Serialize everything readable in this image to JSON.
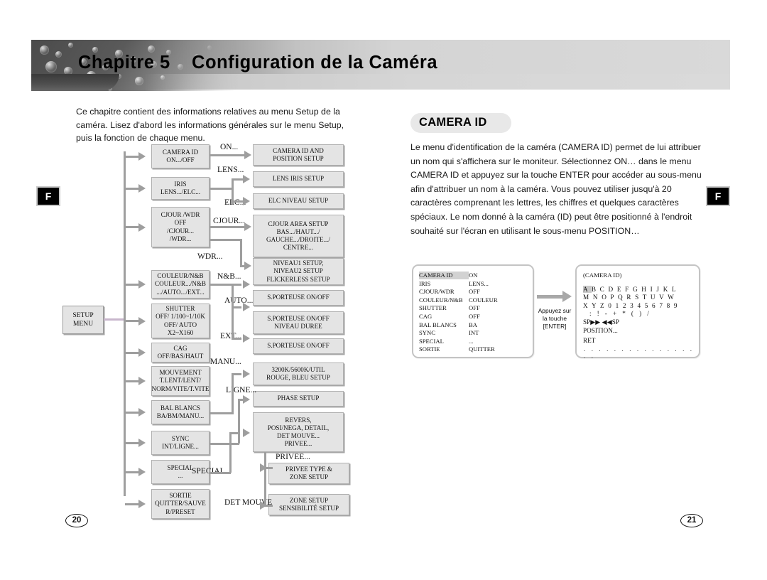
{
  "header": {
    "chapter_label": "Chapitre 5",
    "chapter_title": "Configuration de la Caméra",
    "title_full": "Chapitre 5    Configuration de la Caméra"
  },
  "left_page": {
    "intro": "Ce chapitre contient des informations relatives au menu Setup de la caméra. Lisez d'abord les informations générales sur le menu Setup, puis la fonction de chaque menu.",
    "side_tab": "F",
    "page_number": "20"
  },
  "right_page": {
    "section_title": "CAMERA ID",
    "body": "Le menu d'identification de la caméra (CAMERA ID) permet de lui attribuer un nom qui s'affichera sur le moniteur. Sélectionnez ON… dans le menu CAMERA ID et appuyez sur la touche ENTER pour accéder au sous-menu afin d'attribuer un nom à la caméra. Vous pouvez utiliser jusqu'à 20 caractères comprenant les lettres, les chiffres et quelques caractères spéciaux. Le nom donné à la caméra (ID) peut être positionné à l'endroit souhaité sur l'écran en utilisant le sous-menu POSITION…",
    "side_tab": "F",
    "page_number": "21"
  },
  "flowchart": {
    "root": {
      "line1": "SETUP",
      "line2": "MENU"
    },
    "menu_items": [
      {
        "name": "camera-id",
        "lines": [
          "CAMERA ID",
          "ON.../OFF"
        ]
      },
      {
        "name": "iris",
        "lines": [
          "IRIS",
          "LENS.../ELC..."
        ]
      },
      {
        "name": "cjour-wdr",
        "lines": [
          "CJOUR /WDR",
          "OFF",
          "/CJOUR...",
          "/WDR..."
        ]
      },
      {
        "name": "couleur-nb",
        "lines": [
          "COULEUR/N&B",
          "COULEUR.../N&B",
          ".../AUTO.../EXT..."
        ]
      },
      {
        "name": "shutter",
        "lines": [
          "SHUTTER",
          "OFF/ 1/100~1/10K",
          "OFF/ AUTO",
          "X2~X160"
        ]
      },
      {
        "name": "cag",
        "lines": [
          "CAG",
          "OFF/BAS/HAUT"
        ]
      },
      {
        "name": "mouvement",
        "lines": [
          "MOUVEMENT",
          "T.LENT/LENT/",
          "NORM/VITE/T.VITE"
        ]
      },
      {
        "name": "bal-blancs",
        "lines": [
          "BAL BLANCS",
          "BA/BM/MANU..."
        ]
      },
      {
        "name": "sync",
        "lines": [
          "SYNC",
          "INT/LIGNE..."
        ]
      },
      {
        "name": "special",
        "lines": [
          "SPECIAL",
          "..."
        ]
      },
      {
        "name": "sortie",
        "lines": [
          "SORTIE",
          "QUITTER/SAUVE",
          "R/PRESET"
        ]
      }
    ],
    "submenus": [
      {
        "name": "camera-id-position-setup",
        "lines": [
          "CAMERA ID AND",
          "POSITION SETUP"
        ]
      },
      {
        "name": "lens-iris-setup",
        "lines": [
          "LENS IRIS SETUP"
        ]
      },
      {
        "name": "elc-niveau-setup",
        "lines": [
          "ELC NIVEAU SETUP"
        ]
      },
      {
        "name": "cjour-area-setup",
        "lines": [
          "CJOUR AREA SETUP",
          "BAS.../HAUT.../",
          "GAUCHE.../DROITE.../",
          "CENTRE..."
        ]
      },
      {
        "name": "niveau-flickerless-setup",
        "lines": [
          "NIVEAU1 SETUP,",
          "NIVEAU2 SETUP",
          "FLICKERLESS SETUP"
        ]
      },
      {
        "name": "sporteuse-onoff-1",
        "lines": [
          "S.PORTEUSE ON/OFF"
        ]
      },
      {
        "name": "sporteuse-niveau-duree",
        "lines": [
          "S.PORTEUSE ON/OFF",
          "NIVEAU DUREE"
        ]
      },
      {
        "name": "sporteuse-onoff-2",
        "lines": [
          "S.PORTEUSE ON/OFF"
        ]
      },
      {
        "name": "rouge-bleu-setup",
        "lines": [
          "3200K/5600K/UTIL",
          "ROUGE, BLEU SETUP"
        ]
      },
      {
        "name": "phase-setup",
        "lines": [
          "PHASE SETUP"
        ]
      },
      {
        "name": "special-setup",
        "lines": [
          "REVERS,",
          "POSI/NEGA, DETAIL,",
          "DET MOUVE...",
          "PRIVEE..."
        ]
      },
      {
        "name": "privee-type-zone-setup",
        "lines": [
          "PRIVEE TYPE &",
          "ZONE  SETUP"
        ]
      },
      {
        "name": "zone-sensibilite-setup",
        "lines": [
          "ZONE SETUP",
          "SENSIBILITÉ SETUP"
        ]
      }
    ],
    "connector_labels": [
      {
        "name": "on",
        "text": "ON..."
      },
      {
        "name": "lens",
        "text": "LENS..."
      },
      {
        "name": "elc",
        "text": "ELC..."
      },
      {
        "name": "cjour",
        "text": "CJOUR..."
      },
      {
        "name": "wdr",
        "text": "WDR..."
      },
      {
        "name": "nb",
        "text": "N&B..."
      },
      {
        "name": "auto",
        "text": "AUTO..."
      },
      {
        "name": "ext",
        "text": "EXT..."
      },
      {
        "name": "manu",
        "text": "MANU..."
      },
      {
        "name": "ligne",
        "text": "LIGNE..."
      },
      {
        "name": "privee",
        "text": "PRIVEE..."
      },
      {
        "name": "special",
        "text": "SPECIAL..."
      },
      {
        "name": "det-mouve",
        "text": "DET MOUVE"
      }
    ]
  },
  "osd_main": {
    "rows": [
      {
        "key": "CAMERA ID",
        "value": "ON",
        "selected": true
      },
      {
        "key": "IRIS",
        "value": "LENS...",
        "selected": false
      },
      {
        "key": "CJOUR/WDR",
        "value": "OFF",
        "selected": false
      },
      {
        "key": "COULEUR/N&B",
        "value": "COULEUR",
        "selected": false
      },
      {
        "key": "SHUTTER",
        "value": "OFF",
        "selected": false
      },
      {
        "key": "CAG",
        "value": "OFF",
        "selected": false
      },
      {
        "key": "BAL BLANCS",
        "value": "BA",
        "selected": false
      },
      {
        "key": "SYNC",
        "value": "INT",
        "selected": false
      },
      {
        "key": "SPECIAL",
        "value": "...",
        "selected": false
      },
      {
        "key": "SORTIE",
        "value": "QUITTER",
        "selected": false
      }
    ]
  },
  "osd_id": {
    "title": "(CAMERA ID)",
    "char_rows": [
      "A B C D E F G H I J K L",
      "M N O P Q R S T U V W",
      "X Y Z 0 1 2 3 4 5 6 7 8 9",
      ": ! - + * ( ) /"
    ],
    "selected_char": "A",
    "sp_row": "SP▶▶ ◀◀SP",
    "position_label": "POSITION...",
    "ret_label": "RET",
    "id_placeholder": ". . . . . . . . . . . . . . . . ."
  },
  "press_enter": {
    "caption_line1": "Appuyez sur",
    "caption_line2": "la touche",
    "caption_line3": "[ENTER]",
    "caption": "Appuyez sur la touche [ENTER]"
  },
  "colors": {
    "box_fill": "#e4e4e4",
    "box_border": "#b0b0b0",
    "connector": "#9e9e9e",
    "root_link": "#c8b6cc",
    "osd_border": "#c4c4c4",
    "selection": "#d2d2d2",
    "tab_bg": "#000000"
  }
}
